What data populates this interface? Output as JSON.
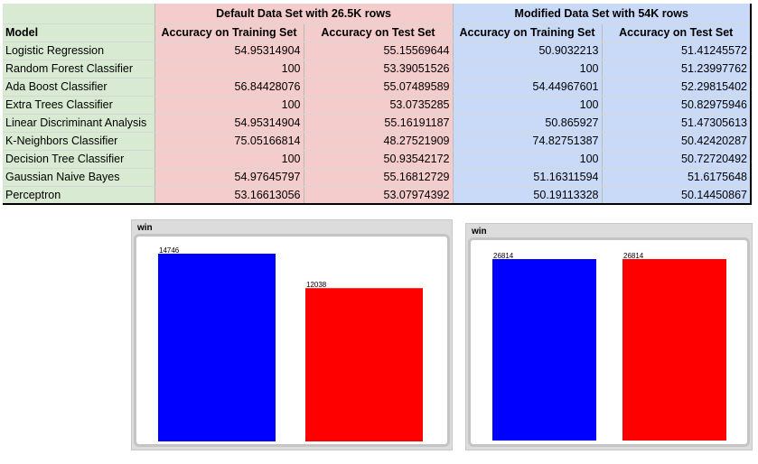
{
  "table": {
    "group_headers": {
      "default": "Default Data Set with 26.5K rows",
      "modified": "Modified Data Set with 54K rows"
    },
    "columns": {
      "model": "Model",
      "default_train": "Accuracy on Training Set",
      "default_test": "Accuracy on Test Set",
      "modified_train": "Accuracy on Training Set",
      "modified_test": "Accuracy on Test Set"
    },
    "rows": [
      {
        "model": "Logistic Regression",
        "default_train": "54.95314904",
        "default_test": "55.15569644",
        "modified_train": "50.9032213",
        "modified_test": "51.41245572"
      },
      {
        "model": "Random Forest Classifier",
        "default_train": "100",
        "default_test": "53.39051526",
        "modified_train": "100",
        "modified_test": "51.23997762"
      },
      {
        "model": "Ada Boost Classifier",
        "default_train": "56.84428076",
        "default_test": "55.07489589",
        "modified_train": "54.44967601",
        "modified_test": "52.29815402"
      },
      {
        "model": "Extra Trees Classifier",
        "default_train": "100",
        "default_test": "53.0735285",
        "modified_train": "100",
        "modified_test": "50.82975946"
      },
      {
        "model": "Linear Discriminant Analysis",
        "default_train": "54.95314904",
        "default_test": "55.16191187",
        "modified_train": "50.865927",
        "modified_test": "51.47305613"
      },
      {
        "model": "K-Neighbors Classifier",
        "default_train": "75.05166814",
        "default_test": "48.27521909",
        "modified_train": "74.82751387",
        "modified_test": "50.42420287"
      },
      {
        "model": "Decision Tree Classifier",
        "default_train": "100",
        "default_test": "50.93542172",
        "modified_train": "100",
        "modified_test": "50.72720492"
      },
      {
        "model": "Gaussian Naive Bayes",
        "default_train": "54.97645797",
        "default_test": "55.16812729",
        "modified_train": "51.16311594",
        "modified_test": "51.6175648"
      },
      {
        "model": "Perceptron",
        "default_train": "53.16613056",
        "default_test": "53.07974392",
        "modified_train": "50.19113328",
        "modified_test": "50.14450867"
      }
    ]
  },
  "chart_data": [
    {
      "type": "bar",
      "title": "win",
      "categories": [
        "",
        ""
      ],
      "values": [
        14746,
        12038
      ],
      "colors": [
        "#0000ff",
        "#ff0000"
      ],
      "ylim": [
        0,
        14746
      ]
    },
    {
      "type": "bar",
      "title": "win",
      "categories": [
        "",
        ""
      ],
      "values": [
        26814,
        26814
      ],
      "colors": [
        "#0000ff",
        "#ff0000"
      ],
      "ylim": [
        0,
        26814
      ]
    }
  ]
}
